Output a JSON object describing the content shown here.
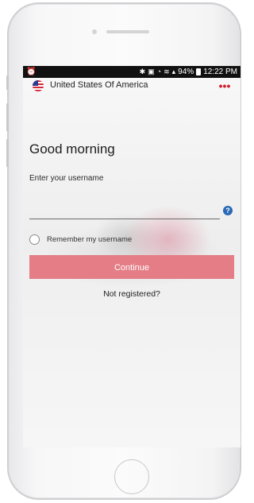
{
  "status_bar": {
    "left_icon": "alarm-icon",
    "battery_percent": "94%",
    "time": "12:22 PM"
  },
  "country": {
    "name": "United States Of America",
    "flag_icon": "us-flag-icon"
  },
  "menu": {
    "more_label": "•••"
  },
  "greeting": "Good morning",
  "form": {
    "username_label": "Enter your username",
    "username_value": "",
    "help_label": "?",
    "remember_label": "Remember my username",
    "continue_label": "Continue",
    "not_registered_label": "Not registered?"
  },
  "colors": {
    "accent": "#e47d86",
    "more_dots": "#d32030",
    "help": "#2a69b5"
  }
}
